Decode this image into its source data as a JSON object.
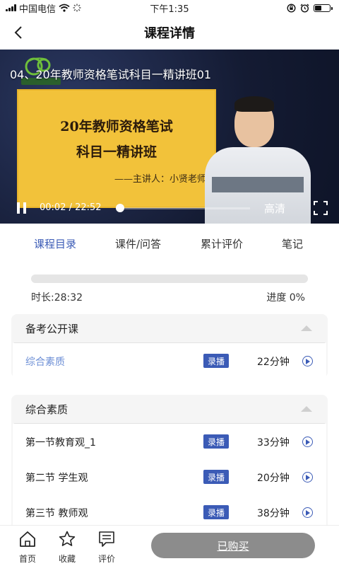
{
  "status_bar": {
    "carrier": "中国电信",
    "time": "下午1:35",
    "battery_level": 0.45
  },
  "header": {
    "title": "课程详情"
  },
  "video": {
    "title": "04、20年教师资格笔试科目一精讲班01",
    "slide_line1": "20年教师资格笔试",
    "slide_line2": "科目一精讲班",
    "slide_presenter": "——主讲人：小贤老师",
    "time_text": "00:02  /  22:52",
    "quality": "高清",
    "position_seconds": 2,
    "duration_seconds": 1372
  },
  "tabs": [
    {
      "label": "课程目录",
      "active": true
    },
    {
      "label": "课件/问答",
      "active": false
    },
    {
      "label": "累计评价",
      "active": false
    },
    {
      "label": "笔记",
      "active": false
    }
  ],
  "course_progress": {
    "duration_label": "时长:28:32",
    "progress_label": "进度 0%",
    "percent": 0
  },
  "sections": [
    {
      "title": "备考公开课",
      "lessons": [
        {
          "title": "综合素质",
          "type": "录播",
          "minutes": "22分钟",
          "highlight": true
        }
      ]
    },
    {
      "title": "综合素质",
      "lessons": [
        {
          "title": "第一节教育观_1",
          "type": "录播",
          "minutes": "33分钟",
          "highlight": false
        },
        {
          "title": "第二节 学生观",
          "type": "录播",
          "minutes": "20分钟",
          "highlight": false
        },
        {
          "title": "第三节 教师观",
          "type": "录播",
          "minutes": "38分钟",
          "highlight": false
        }
      ]
    }
  ],
  "bottom_nav": {
    "home": "首页",
    "favorite": "收藏",
    "review": "评价",
    "buy_button": "已购买"
  },
  "colors": {
    "accent": "#3b5bb6",
    "highlight": "#6d8fd6",
    "slide": "#f2c23a",
    "buy_button": "#8c8c8c"
  },
  "icons": [
    "back-arrow-icon",
    "wifi-icon",
    "alarm-icon",
    "battery-icon",
    "pause-icon",
    "fullscreen-icon",
    "collapse-caret-icon",
    "play-circle-icon",
    "home-icon",
    "star-icon",
    "comment-icon"
  ]
}
